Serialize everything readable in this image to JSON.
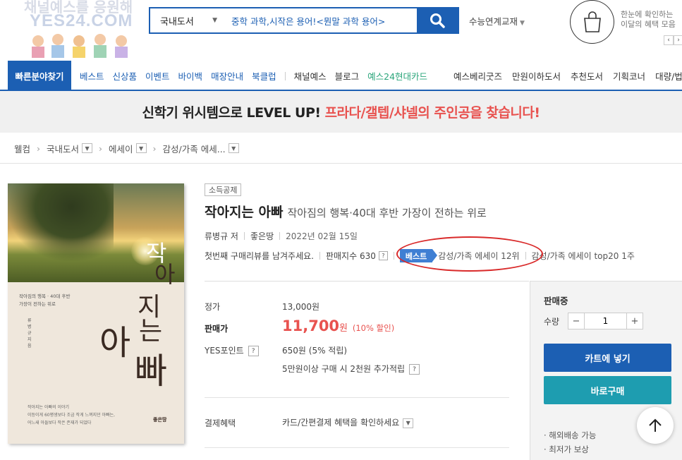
{
  "header": {
    "logo_text": "YES24.COM",
    "logo_tagline": "채널예스를 응원해",
    "search_category": "국내도서",
    "search_value": "중학 과학,시작은 용어!<뭔말 과학 용어>",
    "suneung_label": "수능연계교재",
    "benefit_line1": "한눈에 확인하는",
    "benefit_line2": "이달의 혜택 모음"
  },
  "nav": {
    "quick_label": "빠른분야찾기",
    "items": [
      "베스트",
      "신상품",
      "이벤트",
      "바이백",
      "매장안내",
      "북클럽",
      "채널예스",
      "블로그",
      "예스24현대카드"
    ],
    "right_items": [
      "예스베리굿즈",
      "만원이하도서",
      "추천도서",
      "기획코너",
      "대량/법인"
    ]
  },
  "banner": {
    "main": "신학기 위시템으로 LEVEL UP!",
    "highlight": "프라다/갤텝/샤넬의 주인공을 찾습니다!"
  },
  "breadcrumb": [
    "웰컴",
    "국내도서",
    "에세이",
    "감성/가족 에세..."
  ],
  "cover": {
    "title_chars": [
      "작",
      "아",
      "지",
      "는",
      "아",
      "빠"
    ],
    "subtitle1": "작아짐의 행복 · 40대 후반",
    "subtitle2": "가장이 전하는 위로",
    "author": "류병규 지음",
    "bottom1": "작아지는 아빠의 이야기",
    "bottom2": "이등이게 60평생보다 조금 작게 느껴지던 아빠는,",
    "bottom3": "어느새 아들보다 작은 존재가 되었다",
    "publisher": "좋은땅"
  },
  "product": {
    "badge": "소득공제",
    "title": "작아지는 아빠",
    "subtitle": "작아짐의 행복·40대 후반 가장이 전하는 위로",
    "author": "류병규 저",
    "publisher": "좋은땅",
    "date": "2022년 02월 15일",
    "review_prompt": "첫번째 구매리뷰를 남겨주세요.",
    "sales_index": "판매지수 630",
    "best_label": "베스트",
    "best_rank": "감성/가족 에세이 12위",
    "best_top20": "감성/가족 에세이 top20 1주"
  },
  "price": {
    "list_label": "정가",
    "list_value": "13,000원",
    "sale_label": "판매가",
    "sale_value": "11,700",
    "sale_unit": "원",
    "sale_pct": "(10% 할인)",
    "point_label": "YES포인트",
    "point_value": "650원 (5% 적립)",
    "point_extra": "5만원이상 구매 시 2천원 추가적립",
    "benefit_label": "결제혜택",
    "benefit_value": "카드/간편결제 혜택을 확인하세요"
  },
  "side": {
    "status": "판매중",
    "qty_label": "수량",
    "qty_value": "1",
    "cart_label": "카트에 넣기",
    "buy_label": "바로구매",
    "note1": "· 해외배송 가능",
    "note2": "· 최저가 보상"
  },
  "colors": {
    "brand_blue": "#1c5fb3",
    "sale_red": "#e8524f",
    "buy_teal": "#1e9db0",
    "ring_red": "#d92a2a"
  },
  "icons": [
    "search-icon",
    "shopping-bag-icon",
    "chevron-left-icon",
    "chevron-right-icon",
    "arrow-up-icon",
    "chevron-down-icon"
  ]
}
